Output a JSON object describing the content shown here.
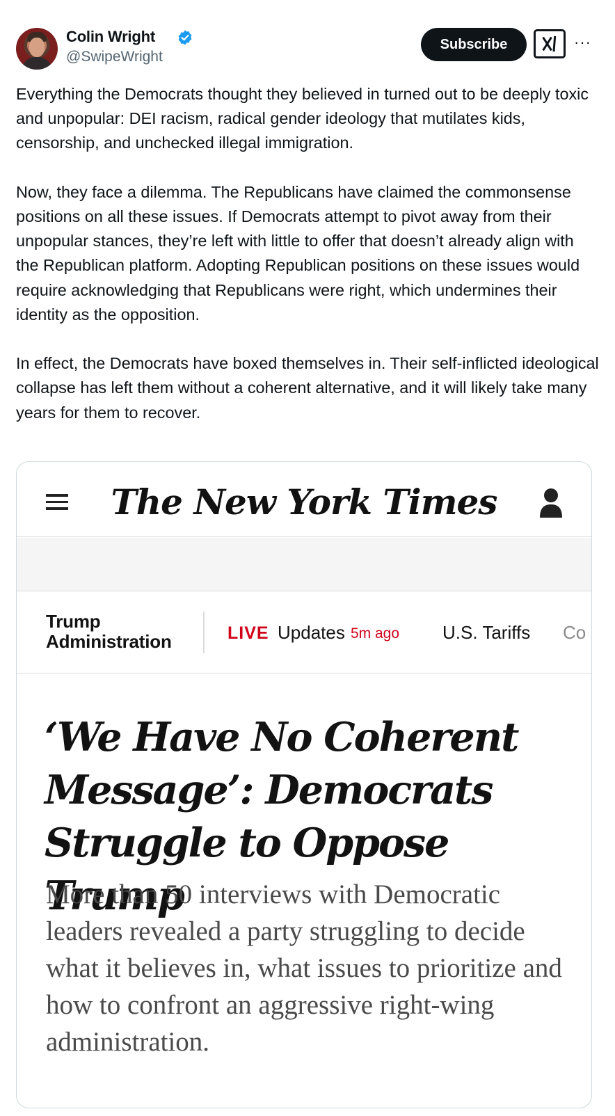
{
  "tweet": {
    "author_name": "Colin Wright",
    "author_handle": "@SwipeWright",
    "subscribe_label": "Subscribe",
    "more_label": "···",
    "verified_color": "#1d9bf0",
    "paragraphs": [
      "Everything the Democrats thought they believed in turned out to be deeply toxic and unpopular: DEI racism, radical gender ideology that mutilates kids, censorship, and unchecked illegal immigration.",
      "Now, they face a dilemma. The Republicans have claimed the commonsense positions on all these issues. If Democrats attempt to pivot away from their unpopular stances, they’re left with little to offer that doesn’t already align with the Republican platform. Adopting Republican positions on these issues would require acknowledging that Republicans were right, which undermines their identity as the opposition.",
      "In effect, the Democrats have boxed themselves in. Their self-inflicted ideological collapse has left them without a coherent alternative, and it will likely take many years for them to recover."
    ]
  },
  "embed": {
    "logo": "The New York Times",
    "section": "Trump Administration",
    "live_label": "LIVE",
    "updates_label": "Updates",
    "time_ago": "5m ago",
    "tariffs_link": "U.S. Tariffs",
    "truncated_link": "Co",
    "headline": "‘We Have No Coherent Message’: Democrats Struggle to Oppose Trump",
    "summary": "More than 50 interviews with Democratic leaders revealed a party struggling to decide what it believes in, what issues to prioritize and how to confront an aggressive right-wing administration.",
    "live_color": "#d0021b"
  }
}
